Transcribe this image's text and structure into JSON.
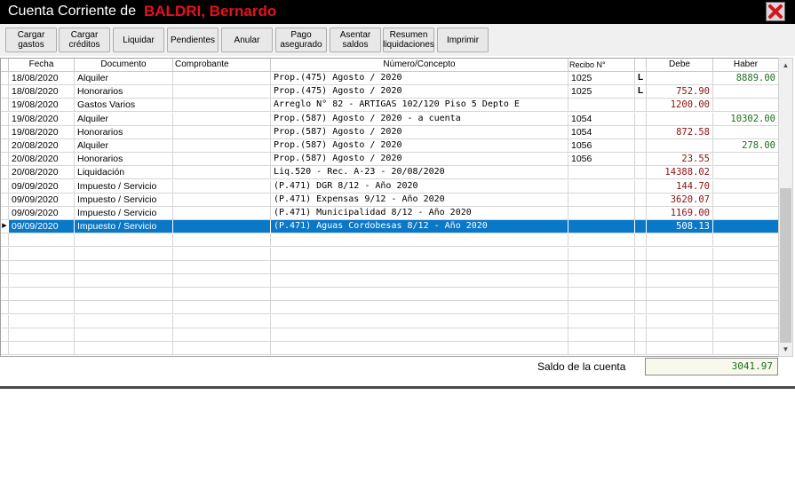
{
  "window": {
    "title_prefix": "Cuenta Corriente de",
    "client_name": "BALDRI, Bernardo"
  },
  "toolbar": {
    "buttons": [
      "Cargar\ngastos",
      "Cargar\ncréditos",
      "Liquidar",
      "Pendientes",
      "Anular",
      "Pago\nasegurado",
      "Asentar\nsaldos",
      "Resumen\nliquidaciones",
      "Imprimir"
    ]
  },
  "table": {
    "columns": [
      "Fecha",
      "Documento",
      "Comprobante",
      "Número/Concepto",
      "Recibo N°",
      "",
      "Debe",
      "Haber"
    ],
    "rows": [
      {
        "fecha": "18/08/2020",
        "documento": "Alquiler",
        "comprobante": "",
        "concepto": "Prop.(475) Agosto / 2020",
        "recibo": "1025",
        "flag": "L",
        "debe": "",
        "haber": "8889.00"
      },
      {
        "fecha": "18/08/2020",
        "documento": "Honorarios",
        "comprobante": "",
        "concepto": "Prop.(475) Agosto / 2020",
        "recibo": "1025",
        "flag": "L",
        "debe": "752.90",
        "haber": ""
      },
      {
        "fecha": "19/08/2020",
        "documento": "Gastos Varios",
        "comprobante": "",
        "concepto": "Arreglo N° 82 - ARTIGAS 102/120 Piso 5 Depto E",
        "recibo": "",
        "flag": "",
        "debe": "1200.00",
        "haber": ""
      },
      {
        "fecha": "19/08/2020",
        "documento": "Alquiler",
        "comprobante": "",
        "concepto": "Prop.(587) Agosto / 2020 - a cuenta",
        "recibo": "1054",
        "flag": "",
        "debe": "",
        "haber": "10302.00"
      },
      {
        "fecha": "19/08/2020",
        "documento": "Honorarios",
        "comprobante": "",
        "concepto": "Prop.(587) Agosto / 2020",
        "recibo": "1054",
        "flag": "",
        "debe": "872.58",
        "haber": ""
      },
      {
        "fecha": "20/08/2020",
        "documento": "Alquiler",
        "comprobante": "",
        "concepto": "Prop.(587) Agosto / 2020",
        "recibo": "1056",
        "flag": "",
        "debe": "",
        "haber": "278.00"
      },
      {
        "fecha": "20/08/2020",
        "documento": "Honorarios",
        "comprobante": "",
        "concepto": "Prop.(587) Agosto / 2020",
        "recibo": "1056",
        "flag": "",
        "debe": "23.55",
        "haber": ""
      },
      {
        "fecha": "20/08/2020",
        "documento": "Liquidación",
        "comprobante": "",
        "concepto": "Liq.520 - Rec. A-23 - 20/08/2020",
        "recibo": "",
        "flag": "",
        "debe": "14388.02",
        "haber": ""
      },
      {
        "fecha": "09/09/2020",
        "documento": "Impuesto / Servicio",
        "comprobante": "",
        "concepto": "(P.471) DGR 8/12 - Año 2020",
        "recibo": "",
        "flag": "",
        "debe": "144.70",
        "haber": ""
      },
      {
        "fecha": "09/09/2020",
        "documento": "Impuesto / Servicio",
        "comprobante": "",
        "concepto": "(P.471) Expensas 9/12 - Año 2020",
        "recibo": "",
        "flag": "",
        "debe": "3620.07",
        "haber": ""
      },
      {
        "fecha": "09/09/2020",
        "documento": "Impuesto / Servicio",
        "comprobante": "",
        "concepto": "(P.471) Municipalidad 8/12 - Año 2020",
        "recibo": "",
        "flag": "",
        "debe": "1169.00",
        "haber": ""
      },
      {
        "fecha": "09/09/2020",
        "documento": "Impuesto / Servicio",
        "comprobante": "",
        "concepto": "(P.471) Aguas Cordobesas 8/12 - Año 2020",
        "recibo": "",
        "flag": "",
        "debe": "508.13",
        "haber": ""
      }
    ],
    "selected_row": 11,
    "empty_rows": 9
  },
  "saldo": {
    "label": "Saldo de la cuenta",
    "value": "3041.97"
  },
  "colors": {
    "title_client": "#e8101c",
    "debe": "#8b1010",
    "haber": "#1c6e1c",
    "selection": "#0a78c8"
  }
}
